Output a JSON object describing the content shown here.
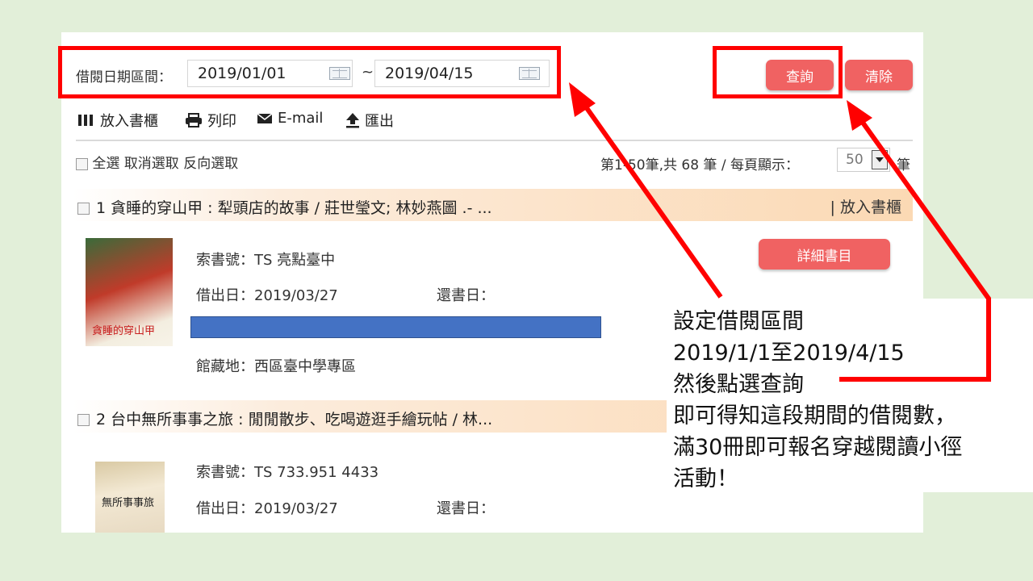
{
  "filter": {
    "label": "借閱日期區間：",
    "start_date": "2019/01/01",
    "separator": "~",
    "end_date": "2019/04/15",
    "query_button": "查詢",
    "clear_button": "清除"
  },
  "toolbar": {
    "add_shelf": "放入書櫃",
    "print": "列印",
    "email": "E-mail",
    "export": "匯出"
  },
  "selection": {
    "select_all": "全選",
    "cancel_select": "取消選取",
    "invert_select": "反向選取",
    "page_info": "第1-50筆,共 68 筆 /  每頁顯示：",
    "per_page": "50",
    "unit": "筆"
  },
  "records": [
    {
      "number": "1",
      "title": "貪睡的穿山甲 : 犁頭店的故事 / 莊世瑩文; 林妙燕圖 .- ...",
      "add_shelf": "| 放入書櫃",
      "cover_text": "貪睡的穿山甲",
      "call_number": "索書號：TS 亮點臺中",
      "borrow_date": "借出日：2019/03/27",
      "return_date": "還書日：",
      "location": "館藏地：西區臺中學專區",
      "detail_button": "詳細書目"
    },
    {
      "number": "2",
      "title": "台中無所事事之旅 : 閒閒散步、吃喝遊逛手繪玩帖 / 林...",
      "cover_text": "無所事事旅",
      "call_number": "索書號：TS 733.951 4433",
      "borrow_date": "借出日：2019/03/27",
      "return_date": "還書日："
    }
  ],
  "callout": {
    "lines": [
      "設定借閱區間",
      "2019/1/1至2019/4/15",
      "然後點選查詢",
      "即可得知這段期間的借閱數，",
      "滿30冊即可報名穿越閱讀小徑",
      "活動！"
    ]
  },
  "colors": {
    "background": "#e2efd9",
    "button": "#f06262",
    "highlight": "#ff0000",
    "record_bar": "#fbd9b4",
    "redacted_bar": "#4472c4"
  }
}
